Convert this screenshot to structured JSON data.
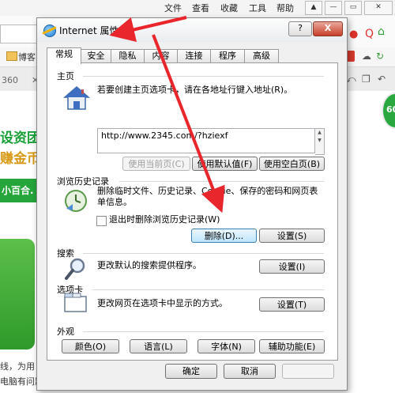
{
  "background": {
    "menu": [
      "文件",
      "查看",
      "收藏",
      "工具",
      "帮助"
    ],
    "bookmark_fragment": "博客",
    "tab_fragment": "360",
    "headline_1": "设资团",
    "headline_2": "赚金币",
    "green_banner": "小百合.",
    "badge": "60",
    "footer_1": "线，为用",
    "footer_2": "电脑有问题"
  },
  "dialog": {
    "title": "Internet 属性",
    "help_button": "?",
    "close_button": "X",
    "tabs": [
      "常规",
      "安全",
      "隐私",
      "内容",
      "连接",
      "程序",
      "高级"
    ],
    "active_tab": "常规",
    "home": {
      "heading": "主页",
      "description": "若要创建主页选项卡，请在各地址行键入地址(R)。",
      "url": "http://www.2345.com/?hziexf",
      "use_current": "使用当前页(C)",
      "use_default": "使用默认值(F)",
      "use_blank": "使用空白页(B)"
    },
    "history": {
      "heading": "浏览历史记录",
      "description": "删除临时文件、历史记录、Cookie、保存的密码和网页表单信息。",
      "checkbox_label": "退出时删除浏览历史记录(W)",
      "delete": "删除(D)...",
      "settings": "设置(S)"
    },
    "search": {
      "heading": "搜索",
      "description": "更改默认的搜索提供程序。",
      "settings": "设置(I)"
    },
    "tabs_section": {
      "heading": "选项卡",
      "description": "更改网页在选项卡中显示的方式。",
      "settings": "设置(T)"
    },
    "appearance": {
      "heading": "外观",
      "colors": "颜色(O)",
      "languages": "语言(L)",
      "fonts": "字体(N)",
      "accessibility": "辅助功能(E)"
    },
    "ok": "确定",
    "cancel": "取消"
  },
  "colors": {
    "arrow": "#e8262b",
    "brand_green": "#25a53a"
  }
}
